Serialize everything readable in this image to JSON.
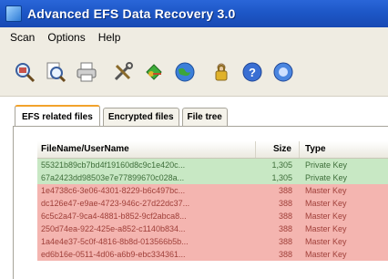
{
  "window": {
    "title": "Advanced EFS Data Recovery 3.0"
  },
  "menu": [
    {
      "label": "Scan"
    },
    {
      "label": "Options"
    },
    {
      "label": "Help"
    }
  ],
  "toolbar": {
    "buttons": [
      {
        "icon": "search-zoom-icon"
      },
      {
        "icon": "search-file-icon"
      },
      {
        "icon": "printer-icon"
      },
      {
        "icon": "tools-icon"
      },
      {
        "icon": "keys-icon"
      },
      {
        "icon": "globe-icon"
      },
      {
        "icon": "user-lock-icon"
      },
      {
        "icon": "help-icon"
      },
      {
        "icon": "about-icon"
      }
    ]
  },
  "tabs": [
    {
      "label": "EFS related files",
      "active": true
    },
    {
      "label": "Encrypted files",
      "active": false
    },
    {
      "label": "File tree",
      "active": false
    }
  ],
  "table": {
    "columns": {
      "name": "FileName/UserName",
      "size": "Size",
      "type": "Type"
    },
    "rows": [
      {
        "name": "55321b89cb7bd4f19160d8c9c1e420c...",
        "size": "1,305",
        "type": "Private Key",
        "kind": "private"
      },
      {
        "name": "67a2423dd98503e7e77899670c028a...",
        "size": "1,305",
        "type": "Private Key",
        "kind": "private"
      },
      {
        "name": "1e4738c6-3e06-4301-8229-b6c497bc...",
        "size": "388",
        "type": "Master Key",
        "kind": "master"
      },
      {
        "name": "dc126e47-e9ae-4723-946c-27d22dc37...",
        "size": "388",
        "type": "Master Key",
        "kind": "master"
      },
      {
        "name": "6c5c2a47-9ca4-4881-b852-9cf2abca8...",
        "size": "388",
        "type": "Master Key",
        "kind": "master"
      },
      {
        "name": "250d74ea-922-425e-a852-c1140b834...",
        "size": "388",
        "type": "Master Key",
        "kind": "master"
      },
      {
        "name": "1a4e4e37-5c0f-4816-8b8d-013566b5b...",
        "size": "388",
        "type": "Master Key",
        "kind": "master"
      },
      {
        "name": "ed6b16e-0511-4d06-a6b9-ebc334361...",
        "size": "388",
        "type": "Master Key",
        "kind": "master"
      }
    ]
  },
  "colors": {
    "titlebar": "#1d57c7",
    "private_row": "#c8e8c4",
    "master_row": "#f4b5b0",
    "active_tab_accent": "#f2a22b"
  }
}
